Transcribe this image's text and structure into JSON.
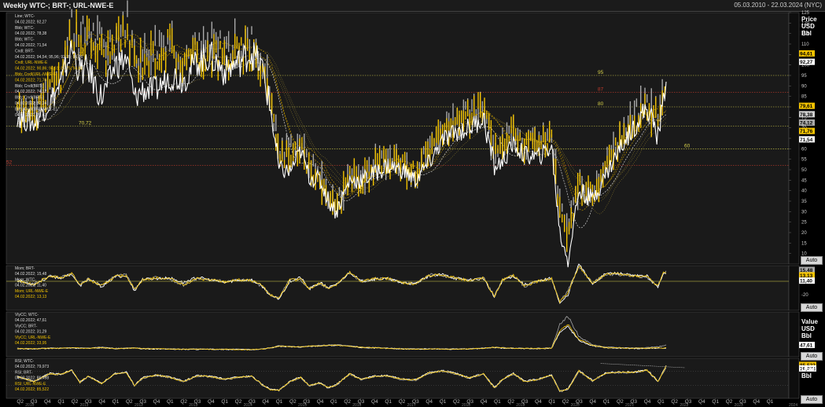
{
  "window": {
    "title": "Weekly WTC-; BRT-; URL-NWE-E",
    "date_range": "05.03.2010 - 22.03.2024 (NYC)"
  },
  "panes": {
    "main": {
      "unit_label": [
        "Price",
        "USD",
        "Bbl"
      ],
      "auto_label": "Auto",
      "legend": [
        "Line; WTC-",
        "04.02.2022; 92,27",
        "Bbb; WTC-",
        "04.02.2022; 78,38",
        "Bbb; WTC-",
        "04.02.2022; 71,54",
        "Cndl; BRT-",
        "04.02.2022; 94,54; 95,96; 92,35; 95,96",
        "Cndl; URL-NWE-E",
        "04.02.2022; 90,86; 94,61; 87,75; 94,61",
        "Bbb; Cndl(URL-NWE-E)",
        "04.02.2022; 71,76",
        "Bbb; Cndl(BRT-)",
        "04.02.2022; 74,12",
        "Bbb; Cndl(BRT-)",
        "04.02.2022; 82,24",
        "Bbb; Cndl(URL-NWE-E)",
        "04.02.2022; 79,61"
      ],
      "level_labels": [
        "95",
        "87",
        "80",
        "70,72",
        "60",
        "52"
      ],
      "value_tags": [
        "94,61",
        "92,27",
        "79,61",
        "78,38",
        "74,12",
        "71,76",
        "71,54"
      ]
    },
    "sub1": {
      "legend": [
        "Mom; BRT-",
        "04.02.2022; 15,48",
        "Mom; WTC-",
        "04.02.2022; 11,40",
        "Mom; URL-NWE-E",
        "04.02.2022; 13,13"
      ],
      "value_tags": [
        "15,48",
        "13,13",
        "11,40"
      ],
      "auto_label": "Auto"
    },
    "sub2": {
      "unit_label": [
        "Value",
        "USD",
        "Bbl"
      ],
      "legend": [
        "VlyCC; WTC-",
        "04.02.2022; 47,61",
        "VlyCC; BRT-",
        "04.02.2022; 31,29",
        "VlyCC; URL-NWE-E",
        "04.02.2022; 33,95"
      ],
      "value_tags": [
        "47,61"
      ],
      "auto_label": "Auto"
    },
    "sub3": {
      "unit_label": [
        "USD",
        "Bbl"
      ],
      "legend": [
        "RSI; WTC-",
        "04.02.2022; 79,973",
        "RSI; BRT-",
        "04.02.2022; 86,498",
        "RSI; URL-NWE-E",
        "04.02.2022; 85,522"
      ],
      "value_tags": [
        "85,522",
        "79,973"
      ],
      "auto_label": "Auto"
    }
  },
  "colors": {
    "brent": "#a9a9a9",
    "wtc": "#ffffff",
    "ulsd": "#f2c200",
    "level_yellow": "#d8d24a",
    "level_red": "#c0392b",
    "background": "#000000"
  },
  "chart_data": [
    {
      "type": "line",
      "title": "Weekly WTC-; BRT-; URL-NWE-E",
      "ylabel": "Price USD Bbl",
      "ylim": [
        0,
        125
      ],
      "y_ticks": [
        10,
        15,
        20,
        25,
        30,
        35,
        40,
        45,
        50,
        55,
        60,
        65,
        70,
        75,
        80,
        85,
        90,
        95,
        100,
        105,
        110,
        115,
        120,
        125
      ],
      "x_ticks": [
        "Q2",
        "Q3",
        "Q4",
        "Q1",
        "Q2",
        "Q3",
        "Q4",
        "Q1",
        "Q2",
        "Q3",
        "Q4",
        "Q1",
        "Q2",
        "Q3",
        "Q4",
        "Q1",
        "Q2",
        "Q3",
        "Q4",
        "Q1",
        "Q2",
        "Q3",
        "Q4",
        "Q1",
        "Q2",
        "Q3",
        "Q4",
        "Q1",
        "Q2",
        "Q3",
        "Q4",
        "Q1",
        "Q2",
        "Q3",
        "Q4",
        "Q1",
        "Q2",
        "Q3",
        "Q4",
        "Q1",
        "Q2",
        "Q3",
        "Q4",
        "Q1",
        "Q2",
        "Q3",
        "Q4",
        "Q1",
        "Q2",
        "Q3",
        "Q4",
        "Q1",
        "Q2",
        "Q3",
        "Q4",
        "Q1",
        "Q2",
        "Q3",
        "Q4",
        "Q1"
      ],
      "year_labels": [
        "2010",
        "2011",
        "2012",
        "2013",
        "2014",
        "2015",
        "2016",
        "2017",
        "2018",
        "2019",
        "2020",
        "2021",
        "2022",
        "2023",
        "2024"
      ],
      "horizontal_levels": [
        95,
        87,
        80,
        70.72,
        60,
        52
      ],
      "x": [
        2010.2,
        2010.5,
        2010.8,
        2011.0,
        2011.2,
        2011.35,
        2011.5,
        2011.75,
        2012.0,
        2012.2,
        2012.35,
        2012.5,
        2012.75,
        2013.0,
        2013.25,
        2013.5,
        2013.75,
        2014.0,
        2014.25,
        2014.5,
        2014.7,
        2014.85,
        2015.0,
        2015.2,
        2015.4,
        2015.55,
        2015.75,
        2015.9,
        2016.05,
        2016.3,
        2016.5,
        2016.75,
        2017.0,
        2017.25,
        2017.5,
        2017.75,
        2018.0,
        2018.25,
        2018.5,
        2018.75,
        2018.95,
        2019.1,
        2019.3,
        2019.5,
        2019.75,
        2020.0,
        2020.15,
        2020.3,
        2020.5,
        2020.75,
        2021.0,
        2021.25,
        2021.5,
        2021.75,
        2021.95,
        2022.05,
        2022.1
      ],
      "series": [
        {
          "name": "BRT-",
          "values": [
            79,
            77,
            88,
            97,
            120,
            112,
            117,
            109,
            112,
            122,
            105,
            104,
            110,
            113,
            103,
            107,
            109,
            108,
            109,
            110,
            102,
            86,
            57,
            61,
            63,
            52,
            48,
            37,
            33,
            47,
            47,
            52,
            56,
            54,
            49,
            60,
            69,
            76,
            75,
            82,
            60,
            61,
            72,
            62,
            63,
            66,
            33,
            21,
            43,
            40,
            53,
            65,
            75,
            82,
            75,
            87,
            94
          ]
        },
        {
          "name": "WTC-",
          "values": [
            76,
            72,
            82,
            91,
            108,
            97,
            98,
            84,
            100,
            103,
            84,
            88,
            88,
            95,
            93,
            102,
            104,
            97,
            101,
            106,
            98,
            78,
            50,
            49,
            59,
            47,
            45,
            36,
            30,
            45,
            45,
            48,
            52,
            50,
            45,
            53,
            64,
            68,
            70,
            75,
            51,
            54,
            62,
            57,
            56,
            61,
            20,
            7,
            40,
            36,
            48,
            60,
            70,
            80,
            66,
            83,
            92
          ]
        },
        {
          "name": "URL-NWE-E",
          "values": [
            80,
            76,
            88,
            95,
            116,
            110,
            114,
            105,
            108,
            116,
            102,
            103,
            106,
            110,
            101,
            104,
            106,
            103,
            105,
            106,
            99,
            84,
            56,
            58,
            60,
            50,
            46,
            35,
            31,
            46,
            45,
            50,
            55,
            52,
            48,
            58,
            67,
            74,
            74,
            80,
            59,
            60,
            70,
            61,
            62,
            64,
            30,
            16,
            42,
            38,
            52,
            63,
            72,
            80,
            73,
            85,
            95
          ]
        }
      ]
    },
    {
      "type": "line",
      "title": "Mom",
      "ylim": [
        -40,
        20
      ],
      "y_ticks": [
        15,
        0,
        -20,
        -40
      ],
      "series": [
        {
          "name": "BRT-",
          "values": [
            2,
            -4,
            8,
            6,
            12,
            -6,
            4,
            -6,
            8,
            10,
            -12,
            2,
            6,
            3,
            -6,
            4,
            2,
            0,
            2,
            1,
            -8,
            -20,
            -26,
            4,
            2,
            -10,
            -4,
            -10,
            -4,
            12,
            0,
            4,
            4,
            -2,
            -4,
            10,
            8,
            6,
            0,
            6,
            -22,
            2,
            10,
            -8,
            0,
            4,
            -30,
            -14,
            22,
            -2,
            10,
            10,
            8,
            6,
            -6,
            12,
            15.48
          ]
        },
        {
          "name": "WTC-",
          "values": [
            1,
            -5,
            7,
            5,
            11,
            -7,
            3,
            -8,
            7,
            8,
            -14,
            3,
            4,
            5,
            -2,
            6,
            2,
            -2,
            2,
            2,
            -8,
            -22,
            -26,
            0,
            6,
            -12,
            -2,
            -9,
            -6,
            14,
            0,
            3,
            4,
            -2,
            -4,
            8,
            10,
            4,
            2,
            4,
            -24,
            2,
            8,
            -5,
            0,
            5,
            -34,
            -20,
            26,
            -4,
            12,
            12,
            8,
            8,
            -10,
            14,
            11.4
          ]
        },
        {
          "name": "URL-NWE-E",
          "values": [
            2,
            -5,
            8,
            5,
            12,
            -6,
            3,
            -7,
            7,
            9,
            -12,
            2,
            5,
            4,
            -5,
            4,
            2,
            -1,
            2,
            1,
            -7,
            -21,
            -25,
            2,
            3,
            -11,
            -3,
            -10,
            -5,
            13,
            0,
            4,
            4,
            -2,
            -4,
            9,
            9,
            5,
            1,
            5,
            -23,
            2,
            9,
            -7,
            0,
            4,
            -31,
            -17,
            23,
            -3,
            11,
            11,
            8,
            7,
            -7,
            13,
            13.13
          ]
        }
      ]
    },
    {
      "type": "line",
      "title": "VlyCC",
      "series": [
        {
          "name": "WTC-",
          "values": [
            30,
            28,
            32,
            31,
            33,
            32,
            31,
            36,
            30,
            31,
            33,
            29,
            29,
            27,
            26,
            27,
            26,
            26,
            25,
            24,
            27,
            34,
            43,
            40,
            38,
            42,
            45,
            47,
            48,
            43,
            36,
            34,
            31,
            28,
            27,
            28,
            27,
            27,
            28,
            31,
            36,
            33,
            31,
            31,
            30,
            32,
            150,
            190,
            90,
            48,
            36,
            34,
            32,
            34,
            38,
            42,
            47.61
          ]
        },
        {
          "name": "BRT-",
          "values": [
            28,
            27,
            30,
            30,
            32,
            31,
            30,
            33,
            29,
            29,
            31,
            28,
            27,
            26,
            25,
            25,
            25,
            24,
            24,
            23,
            26,
            32,
            40,
            38,
            36,
            40,
            42,
            44,
            45,
            40,
            34,
            32,
            30,
            27,
            26,
            27,
            26,
            26,
            27,
            30,
            34,
            31,
            30,
            29,
            29,
            30,
            110,
            140,
            70,
            42,
            33,
            31,
            29,
            30,
            31,
            30,
            31.29
          ]
        },
        {
          "name": "URL-NWE-E",
          "values": [
            29,
            28,
            31,
            30,
            33,
            31,
            30,
            34,
            29,
            30,
            32,
            28,
            28,
            26,
            25,
            26,
            25,
            25,
            24,
            24,
            26,
            33,
            41,
            39,
            37,
            41,
            43,
            45,
            46,
            41,
            35,
            33,
            30,
            27,
            26,
            27,
            26,
            26,
            27,
            30,
            35,
            32,
            30,
            30,
            29,
            31,
            120,
            150,
            75,
            44,
            34,
            32,
            30,
            31,
            33,
            32,
            33.95
          ]
        }
      ]
    },
    {
      "type": "line",
      "title": "RSI",
      "ylim": [
        0,
        100
      ],
      "series": [
        {
          "name": "WTC-",
          "values": [
            55,
            40,
            62,
            60,
            72,
            38,
            55,
            35,
            62,
            66,
            28,
            50,
            58,
            52,
            40,
            56,
            54,
            46,
            52,
            55,
            30,
            18,
            15,
            40,
            52,
            28,
            36,
            22,
            30,
            62,
            46,
            55,
            56,
            46,
            44,
            64,
            70,
            62,
            50,
            62,
            22,
            46,
            62,
            40,
            46,
            58,
            12,
            18,
            70,
            42,
            64,
            66,
            66,
            72,
            40,
            68,
            79.973
          ]
        },
        {
          "name": "BRT-",
          "values": [
            56,
            42,
            64,
            62,
            74,
            40,
            56,
            36,
            64,
            68,
            30,
            52,
            60,
            54,
            42,
            58,
            56,
            48,
            54,
            56,
            32,
            19,
            16,
            42,
            54,
            30,
            38,
            24,
            32,
            64,
            48,
            56,
            58,
            48,
            46,
            66,
            72,
            64,
            52,
            64,
            24,
            48,
            64,
            42,
            48,
            60,
            14,
            20,
            72,
            44,
            66,
            68,
            68,
            74,
            42,
            70,
            86.498
          ]
        },
        {
          "name": "URL-NWE-E",
          "values": [
            55,
            41,
            63,
            61,
            73,
            39,
            56,
            35,
            63,
            67,
            29,
            51,
            59,
            53,
            41,
            57,
            55,
            47,
            53,
            56,
            31,
            18,
            15,
            41,
            53,
            29,
            37,
            23,
            31,
            63,
            47,
            55,
            57,
            47,
            45,
            65,
            71,
            63,
            51,
            63,
            23,
            47,
            63,
            41,
            47,
            59,
            13,
            19,
            71,
            43,
            65,
            67,
            67,
            73,
            41,
            69,
            85.522
          ]
        }
      ]
    }
  ]
}
